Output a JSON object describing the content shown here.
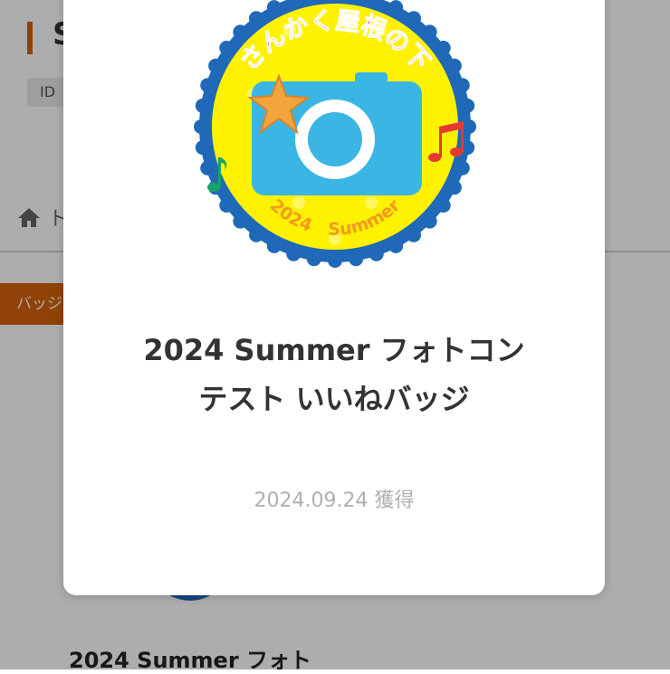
{
  "background": {
    "title_initial": "S",
    "id_label": "ID",
    "breadcrumb_initial": "ト",
    "badge_tab_label": "バッジ",
    "item_title": "2024 Summer フォト"
  },
  "modal": {
    "badge": {
      "arc_text": "さんかく屋根の下",
      "year_text": "2024",
      "season_text": "Summer"
    },
    "title_line1": "2024 Summer フォトコン",
    "title_line2": "テスト いいねバッジ",
    "acquired_date": "2024.09.24 獲得"
  },
  "colors": {
    "accent": "#d4620a",
    "badge_ring": "#1f69b8",
    "badge_fill": "#fff200",
    "camera": "#3bb5e4",
    "arc_text": "#ef5aa0",
    "year_text": "#f29a1e"
  }
}
